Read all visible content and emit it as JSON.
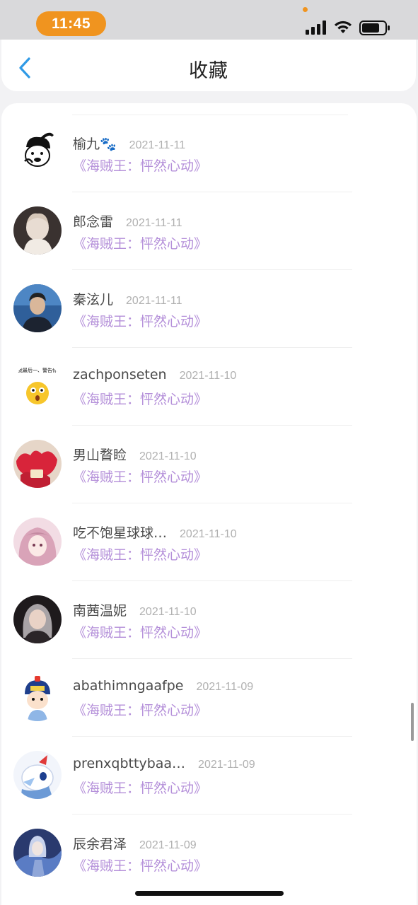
{
  "status_bar": {
    "time": "11:45",
    "signal_icon": "signal-bars-icon",
    "wifi_icon": "wifi-icon",
    "battery_icon": "battery-icon",
    "accent_color": "#f0941f"
  },
  "header": {
    "title": "收藏",
    "back_icon": "chevron-left-icon",
    "back_color": "#2f9ae6"
  },
  "items": [
    {
      "name": "榆九🐾",
      "date": "2021-11-11",
      "title": "《海贼王：怦然心动》"
    },
    {
      "name": "郎念雷",
      "date": "2021-11-11",
      "title": "《海贼王：怦然心动》"
    },
    {
      "name": "秦泫儿",
      "date": "2021-11-11",
      "title": "《海贼王：怦然心动》"
    },
    {
      "name": "zachponseten",
      "date": "2021-11-10",
      "title": "《海贼王：怦然心动》"
    },
    {
      "name": "男山瞀睑",
      "date": "2021-11-10",
      "title": "《海贼王：怦然心动》"
    },
    {
      "name": "吃不饱星球球…",
      "date": "2021-11-10",
      "title": "《海贼王：怦然心动》"
    },
    {
      "name": "南茜温妮",
      "date": "2021-11-10",
      "title": "《海贼王：怦然心动》"
    },
    {
      "name": "abathimngaafpe",
      "date": "2021-11-09",
      "title": "《海贼王：怦然心动》"
    },
    {
      "name": "prenxqbttybaa…",
      "date": "2021-11-09",
      "title": "《海贼王：怦然心动》"
    },
    {
      "name": "辰余君泽",
      "date": "2021-11-09",
      "title": "《海贼王：怦然心动》"
    }
  ],
  "avatar_badges": {
    "warning_sticker_text": "食，我最后一、警告你！！"
  },
  "colors": {
    "title_purple": "#b48fd9",
    "date_gray": "#b0b0b0"
  }
}
